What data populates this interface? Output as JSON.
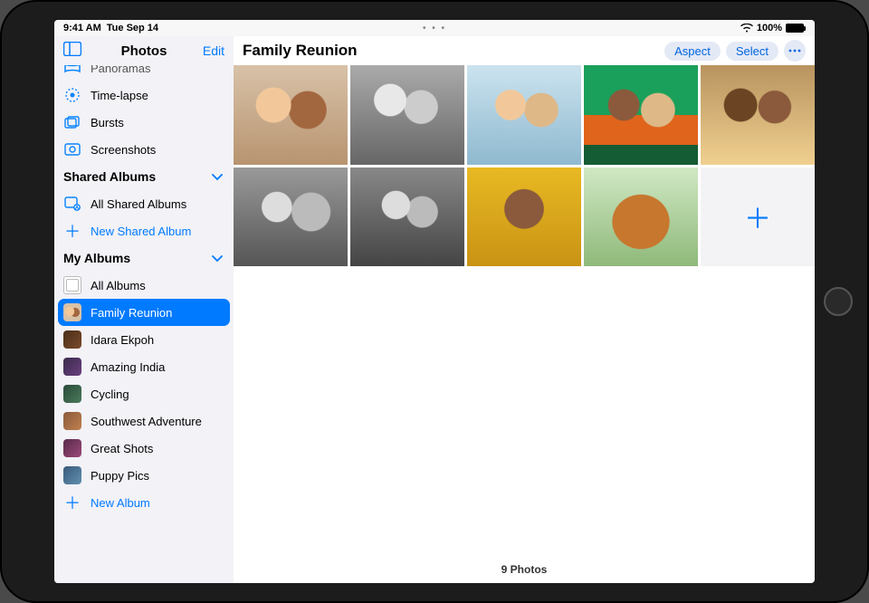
{
  "status": {
    "time": "9:41 AM",
    "date": "Tue Sep 14",
    "multitask_dots": "• • •",
    "battery_pct": "100%"
  },
  "sidebar": {
    "title": "Photos",
    "edit": "Edit",
    "media_types": [
      {
        "label": "Panoramas",
        "icon": "panorama-icon"
      },
      {
        "label": "Time-lapse",
        "icon": "timelapse-icon"
      },
      {
        "label": "Bursts",
        "icon": "bursts-icon"
      },
      {
        "label": "Screenshots",
        "icon": "screenshots-icon"
      }
    ],
    "shared_section": {
      "title": "Shared Albums",
      "all_shared": "All Shared Albums",
      "new_shared": "New Shared Album"
    },
    "my_section": {
      "title": "My Albums",
      "all_albums": "All Albums",
      "albums": [
        {
          "label": "Family Reunion",
          "selected": true
        },
        {
          "label": "Idara Ekpoh"
        },
        {
          "label": "Amazing India"
        },
        {
          "label": "Cycling"
        },
        {
          "label": "Southwest Adventure"
        },
        {
          "label": "Great Shots"
        },
        {
          "label": "Puppy Pics"
        }
      ],
      "new_album": "New Album"
    }
  },
  "content": {
    "title": "Family Reunion",
    "aspect_btn": "Aspect",
    "select_btn": "Select",
    "footer": "9 Photos"
  }
}
